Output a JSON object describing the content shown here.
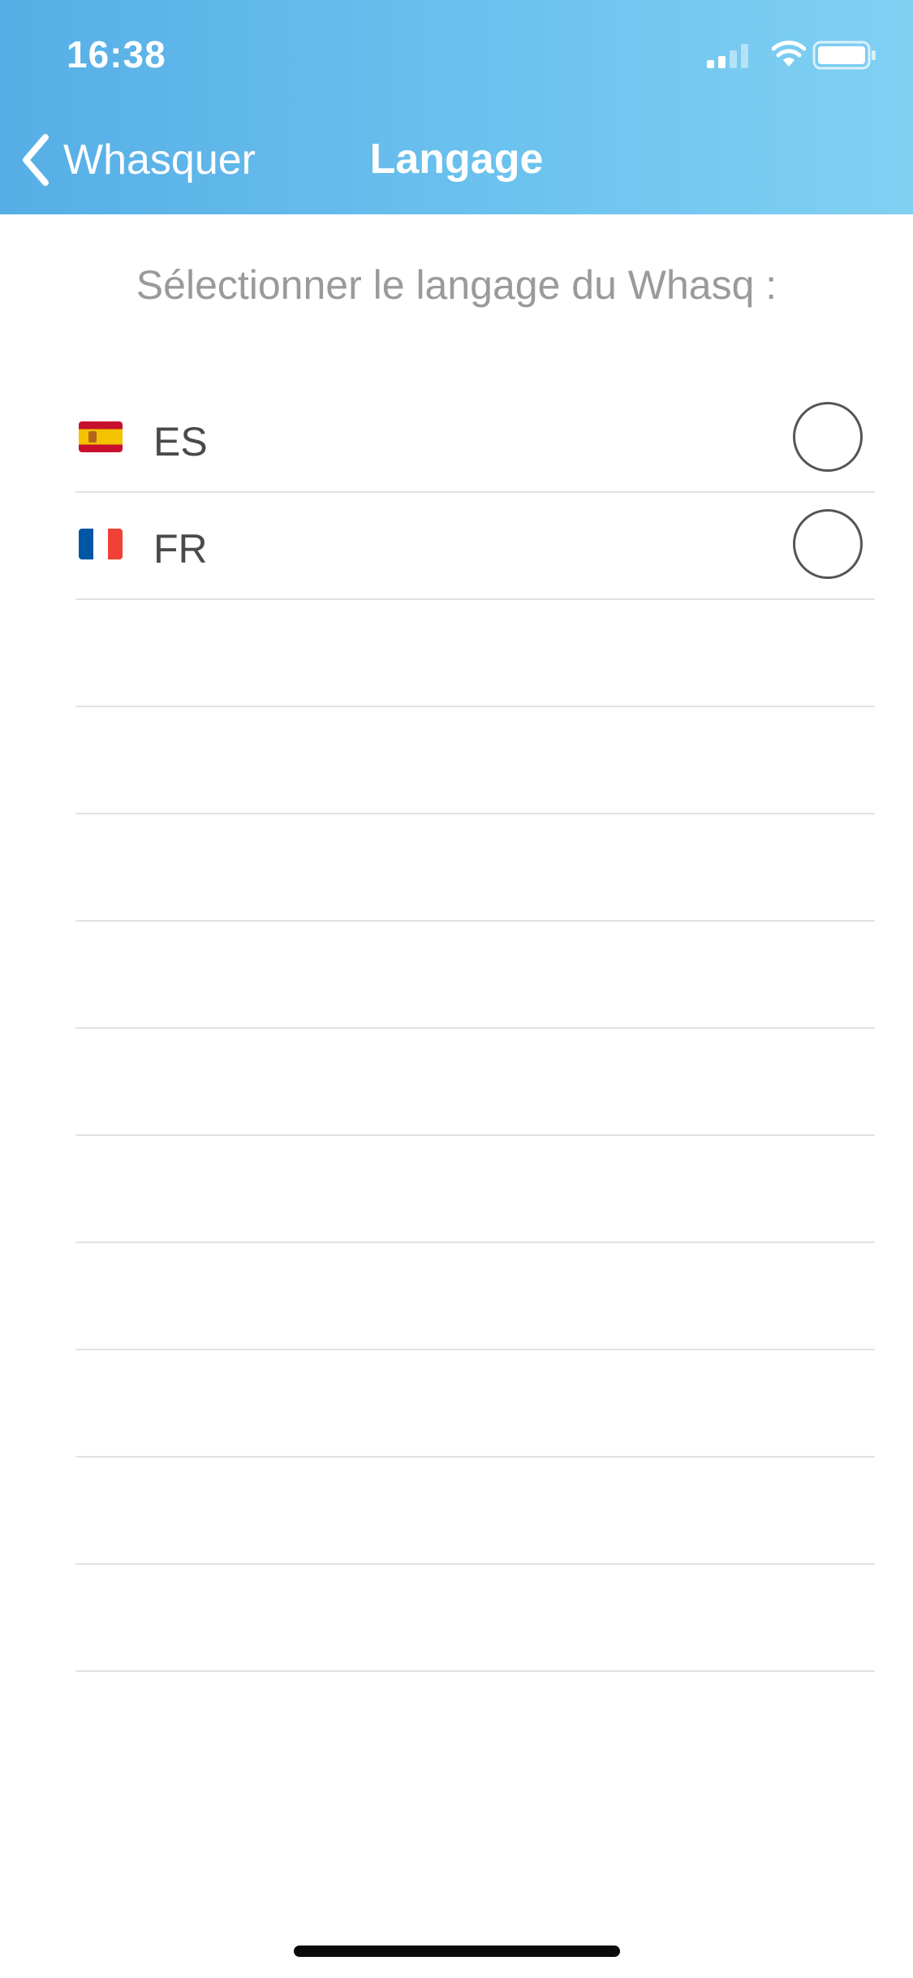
{
  "status_bar": {
    "time": "16:38",
    "icons": [
      "cellular-signal-icon",
      "wifi-icon",
      "battery-icon"
    ]
  },
  "nav": {
    "back_label": "Whasquer",
    "title": "Langage",
    "background_gradient": [
      "#56aee6",
      "#80d0f2"
    ]
  },
  "main": {
    "prompt": "Sélectionner le langage du Whasq :",
    "languages": [
      {
        "code": "ES",
        "flag": "spain-flag-icon",
        "selected": false
      },
      {
        "code": "FR",
        "flag": "france-flag-icon",
        "selected": false
      }
    ]
  },
  "colors": {
    "header_start": "#56aee6",
    "header_end": "#80d0f2",
    "prompt_text": "#9a9a9a",
    "row_text": "#4a4a4a",
    "divider": "#e2e2e2"
  }
}
